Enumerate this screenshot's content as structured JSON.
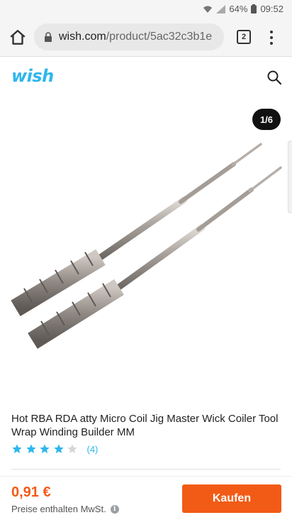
{
  "status_bar": {
    "battery": "64%",
    "time": "09:52"
  },
  "browser": {
    "url_domain": "wish.com",
    "url_path": "/product/5ac32c3b1e",
    "tab_count": "2",
    "icons": [
      "home-icon",
      "lock-icon",
      "tabs-icon",
      "overflow-menu-icon"
    ]
  },
  "header": {
    "logo": "wish",
    "icons": [
      "search-icon"
    ]
  },
  "product": {
    "image_counter": "1/6",
    "title": "Hot RBA RDA atty Micro Coil Jig Master Wick Coiler Tool Wrap Winding Builder MM",
    "rating_value": 4,
    "rating_max": 5,
    "rating_count": "(4)"
  },
  "purchase": {
    "price": "0,91 €",
    "price_note": "Preise enthalten MwSt.",
    "buy_label": "Kaufen"
  },
  "colors": {
    "brand": "#2fb7ec",
    "accent": "#f25b15",
    "star_filled": "#2fb7ec",
    "star_empty": "#d6d6d6"
  }
}
